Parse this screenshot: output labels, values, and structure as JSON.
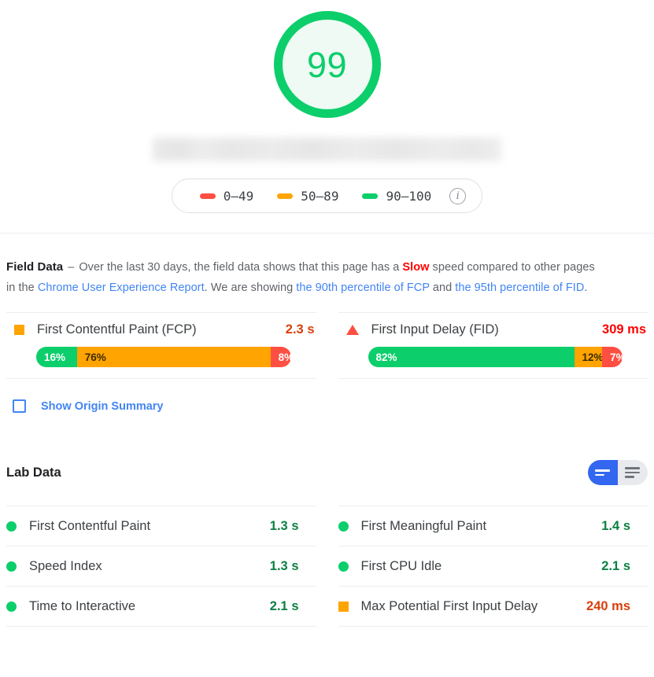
{
  "score": {
    "value": "99",
    "color": "#0CCE6B",
    "background": "#EEFAF3"
  },
  "url_bar": {
    "redacted": true
  },
  "legend": {
    "items": [
      {
        "label": "0–49",
        "color": "#FF4E42",
        "icon": "dash-icon"
      },
      {
        "label": "50–89",
        "color": "#FFA400",
        "icon": "dash-icon"
      },
      {
        "label": "90–100",
        "color": "#0CCE6B",
        "icon": "dash-icon"
      }
    ],
    "info_glyph": "i"
  },
  "field_data": {
    "title": "Field Data",
    "dash": "–",
    "text_1": "Over the last 30 days, the field data shows that this page has a ",
    "slow": "Slow",
    "text_2": " speed compared to other pages in the ",
    "link_crux": "Chrome User Experience Report",
    "text_3": ". We are showing ",
    "link_fcp": "the 90th percentile of FCP",
    "text_4": " and ",
    "link_fid": "the 95th percentile of FID",
    "text_5": ".",
    "metrics": [
      {
        "name": "First Contentful Paint (FCP)",
        "value": "2.3 s",
        "value_color": "#d93f0b",
        "icon": "square-icon",
        "icon_color": "#FFA400",
        "segments": [
          {
            "label": "16%",
            "pct": 16,
            "color": "#0CCE6B",
            "text_color": "#ffffff"
          },
          {
            "label": "76%",
            "pct": 76,
            "color": "#FFA400",
            "text_color": "#3c2b00"
          },
          {
            "label": "8%",
            "pct": 8,
            "color": "#FF4E42",
            "text_color": "#ffffff"
          }
        ]
      },
      {
        "name": "First Input Delay (FID)",
        "value": "309 ms",
        "value_color": "#ff0000",
        "icon": "triangle-icon",
        "icon_color": "#FF4E42",
        "segments": [
          {
            "label": "82%",
            "pct": 81,
            "color": "#0CCE6B",
            "text_color": "#ffffff"
          },
          {
            "label": "12%",
            "pct": 11,
            "color": "#FFA400",
            "text_color": "#3c2b00"
          },
          {
            "label": "7%",
            "pct": 8,
            "color": "#FF4E42",
            "text_color": "#ffffff"
          }
        ]
      }
    ],
    "origin_summary": {
      "label": "Show Origin Summary",
      "checked": false,
      "color": "#4285f4"
    }
  },
  "lab_data": {
    "title": "Lab Data",
    "view_toggle": {
      "active": "compact-view",
      "options": [
        {
          "name": "compact-view",
          "lines": 2,
          "active": true
        },
        {
          "name": "expanded-view",
          "lines": 3,
          "active": false
        }
      ]
    },
    "columns": [
      {
        "rows": [
          {
            "name": "First Contentful Paint",
            "value": "1.3 s",
            "icon": "circle-icon",
            "icon_color": "#0CCE6B",
            "value_color": "#0b8043"
          },
          {
            "name": "Speed Index",
            "value": "1.3 s",
            "icon": "circle-icon",
            "icon_color": "#0CCE6B",
            "value_color": "#0b8043"
          },
          {
            "name": "Time to Interactive",
            "value": "2.1 s",
            "icon": "circle-icon",
            "icon_color": "#0CCE6B",
            "value_color": "#0b8043"
          }
        ]
      },
      {
        "rows": [
          {
            "name": "First Meaningful Paint",
            "value": "1.4 s",
            "icon": "circle-icon",
            "icon_color": "#0CCE6B",
            "value_color": "#0b8043"
          },
          {
            "name": "First CPU Idle",
            "value": "2.1 s",
            "icon": "circle-icon",
            "icon_color": "#0CCE6B",
            "value_color": "#0b8043"
          },
          {
            "name": "Max Potential First Input Delay",
            "value": "240 ms",
            "icon": "square-icon",
            "icon_color": "#FFA400",
            "value_color": "#d93f0b"
          }
        ]
      }
    ]
  }
}
